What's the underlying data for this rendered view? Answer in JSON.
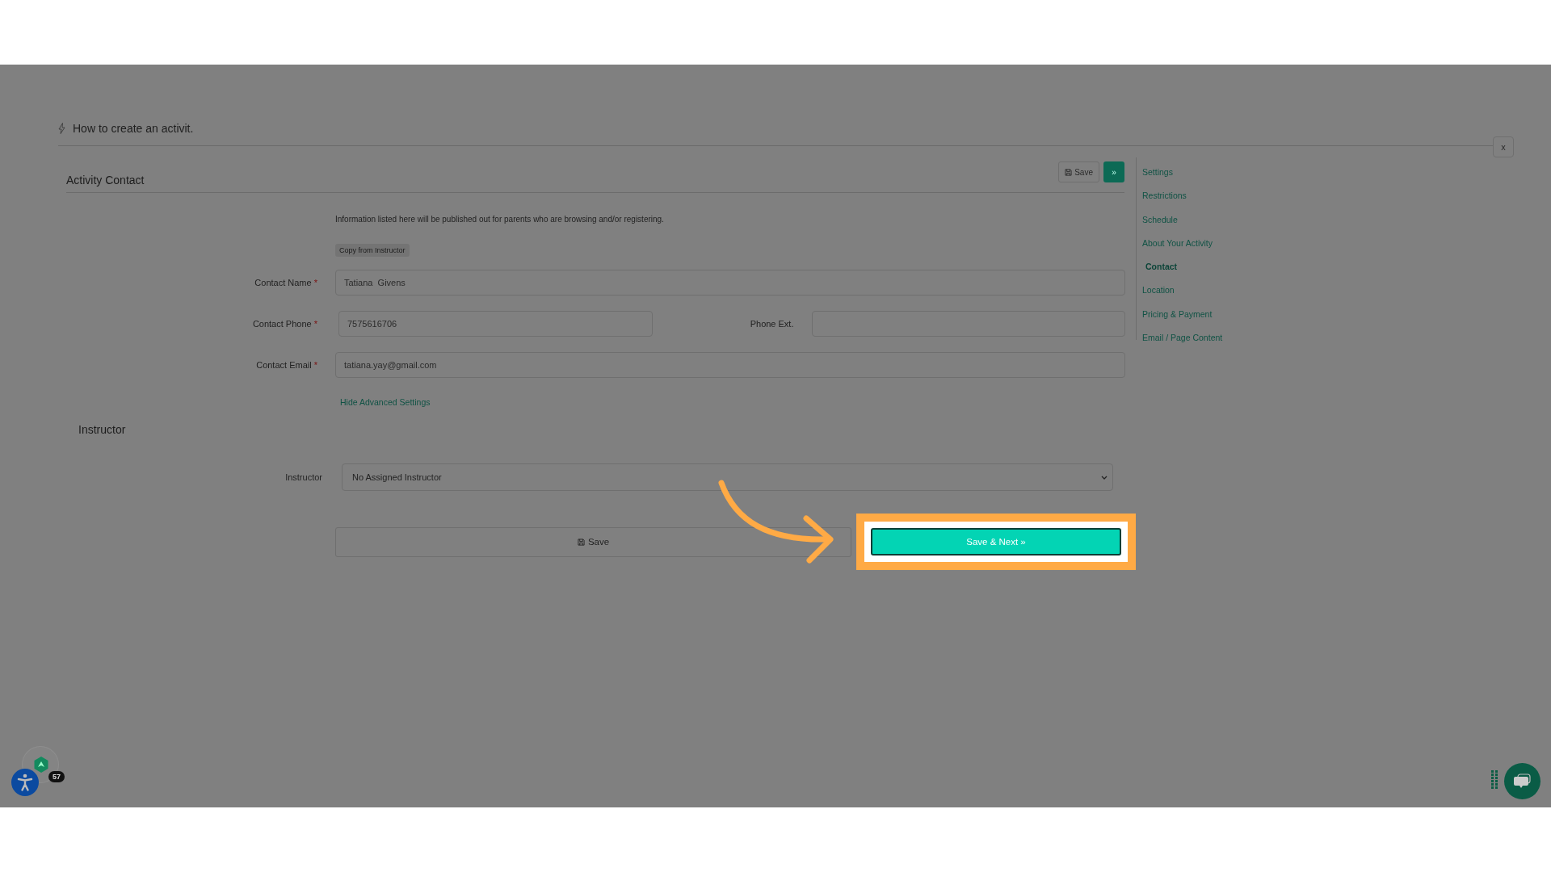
{
  "header": {
    "title": "How to create an activit.",
    "close": "x"
  },
  "section": {
    "title": "Activity Contact",
    "save": "Save",
    "next": "»"
  },
  "info_text": "Information listed here will be published out for parents who are browsing and/or registering.",
  "copy_button": "Copy from Instructor",
  "fields": [
    {
      "kind": "text",
      "label": "Contact Name",
      "required_mark": "*",
      "value": "Tatiana  Givens"
    },
    {
      "kind": "phone",
      "label": "Contact Phone",
      "required_mark": "*",
      "value": "7575616706",
      "ext_label": "Phone Ext."
    },
    {
      "kind": "text",
      "label": "Contact Email",
      "required_mark": "*",
      "value": "tatiana.yay@gmail.com"
    }
  ],
  "advanced_link": "Hide Advanced Settings",
  "instructor": {
    "heading": "Instructor",
    "label": "Instructor",
    "value": "No Assigned Instructor"
  },
  "actions": {
    "save": "Save",
    "save_next": "Save & Next »"
  },
  "sidebar": {
    "items": [
      {
        "label": "Settings",
        "selected": false
      },
      {
        "label": "Restrictions",
        "selected": false
      },
      {
        "label": "Schedule",
        "selected": false
      },
      {
        "label": "About Your Activity",
        "selected": false
      },
      {
        "label": "Contact",
        "selected": true
      },
      {
        "label": "Location",
        "selected": false
      },
      {
        "label": "Pricing & Payment",
        "selected": false
      },
      {
        "label": "Email / Page Content",
        "selected": false
      }
    ]
  },
  "widgets": {
    "badge": "57"
  }
}
